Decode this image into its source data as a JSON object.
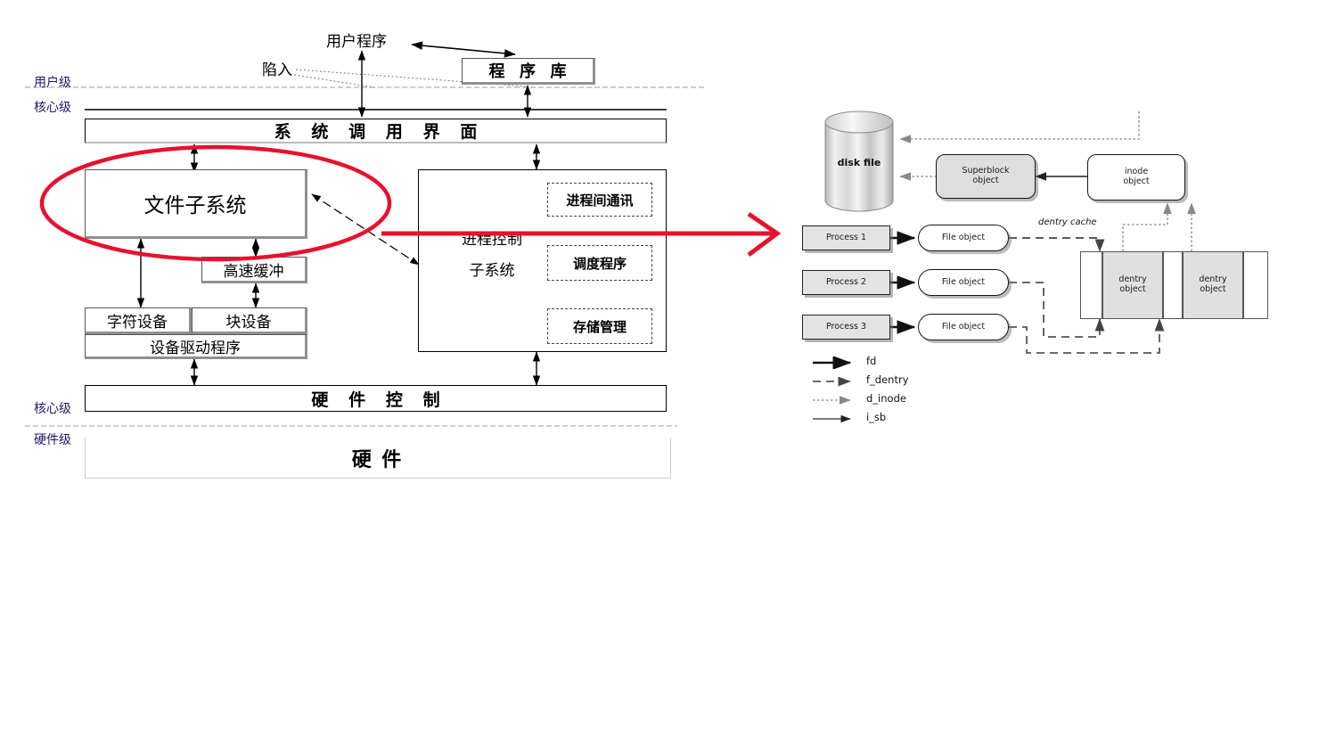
{
  "left_diagram": {
    "title_labels": {
      "user_program": "用户程序",
      "trap": "陷入",
      "program_library": "程 序 库",
      "syscall_interface": "系 统 调 用 界 面",
      "file_subsystem": "文件子系统",
      "buffer_cache": "高速缓冲",
      "char_device": "字符设备",
      "block_device": "块设备",
      "device_driver": "设备驱动程序",
      "process_control_line1": "进程控制",
      "process_control_line2": "子系统",
      "ipc": "进程间通讯",
      "scheduler": "调度程序",
      "memory_management": "存储管理",
      "hardware_control": "硬 件 控 制",
      "hardware": "硬       件"
    },
    "level_labels": {
      "user_level_top": "用户级",
      "kernel_level_top": "核心级",
      "kernel_level_bottom": "核心级",
      "hardware_level": "硬件级"
    }
  },
  "right_diagram": {
    "disk_file": "disk file",
    "superblock_object_line1": "Superblock",
    "superblock_object_line2": "object",
    "inode_object_line1": "inode",
    "inode_object_line2": "object",
    "dentry_cache_caption": "dentry cache",
    "dentry_object_line1": "dentry",
    "dentry_object_line2": "object",
    "processes": [
      "Process 1",
      "Process 2",
      "Process 3"
    ],
    "file_objects": [
      "File object",
      "File object",
      "File object"
    ],
    "legend": [
      {
        "label": "fd",
        "style": "solid-thick"
      },
      {
        "label": "f_dentry",
        "style": "dashed"
      },
      {
        "label": "d_inode",
        "style": "dotted"
      },
      {
        "label": "i_sb",
        "style": "solid-thin"
      }
    ]
  },
  "annotation": {
    "highlight_color": "#e8112d",
    "ellipse_target": "文件子系统",
    "arrow_direction": "left-to-right"
  }
}
